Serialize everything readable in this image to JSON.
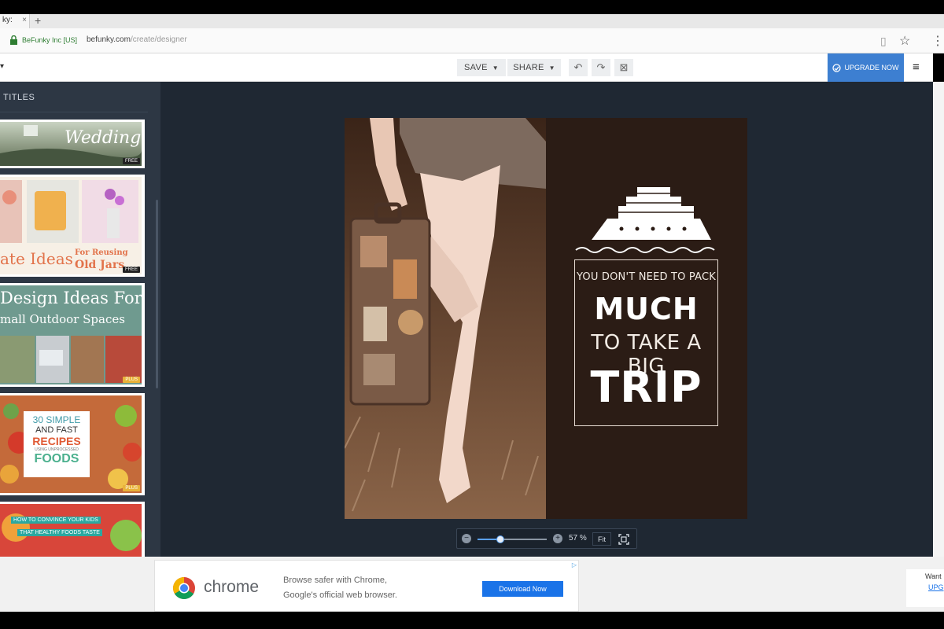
{
  "browser": {
    "tab_title": "ky:",
    "tab_close": "×",
    "new_tab": "+",
    "site_identity": "BeFunky Inc [US]",
    "url_host": "befunky.com",
    "url_path": "/create/designer"
  },
  "app_header": {
    "save_label": "SAVE",
    "share_label": "SHARE",
    "undo_icon": "↶",
    "redo_icon": "↷",
    "close_icon": "⊠",
    "upgrade_label": "UPGRADE NOW",
    "menu_icon": "≡"
  },
  "sidebar": {
    "title": "TITLES",
    "templates": [
      {
        "title": "Wedding",
        "badge": "FREE"
      },
      {
        "title_a": "ate Ideas",
        "title_b": "For Reusing",
        "title_c": "Old Jars",
        "badge": "FREE"
      },
      {
        "title_a": "Design Ideas For",
        "title_b": "mall Outdoor Spaces",
        "badge": "PLUS"
      },
      {
        "title_a": "30 SIMPLE",
        "title_b": "AND FAST",
        "title_c": "RECIPES",
        "title_d": "USING UNPROCESSED",
        "title_e": "FOODS",
        "badge": "PLUS"
      },
      {
        "title_a": "HOW TO CONVINCE YOUR KIDS",
        "title_b": "THAT HEALTHY FOODS TASTE"
      }
    ]
  },
  "poster": {
    "line1": "YOU DON'T NEED TO PACK",
    "line2": "MUCH",
    "line3": "TO TAKE A BIG",
    "line4": "TRIP"
  },
  "zoom": {
    "minus": "−",
    "plus": "+",
    "percent_label": "57 %",
    "fit_label": "Fit",
    "slider_fraction": 0.33
  },
  "ad": {
    "brand": "chrome",
    "line1": "Browse safer with Chrome,",
    "line2": "Google's official web browser.",
    "button": "Download Now",
    "choices": "▷",
    "right_text": "Want",
    "right_link": "UPG"
  },
  "colors": {
    "accent": "#3d7fd1",
    "sidebar_bg": "#2d3744",
    "canvas_bg": "#1f2833",
    "poster_bg": "#2b1c15"
  }
}
